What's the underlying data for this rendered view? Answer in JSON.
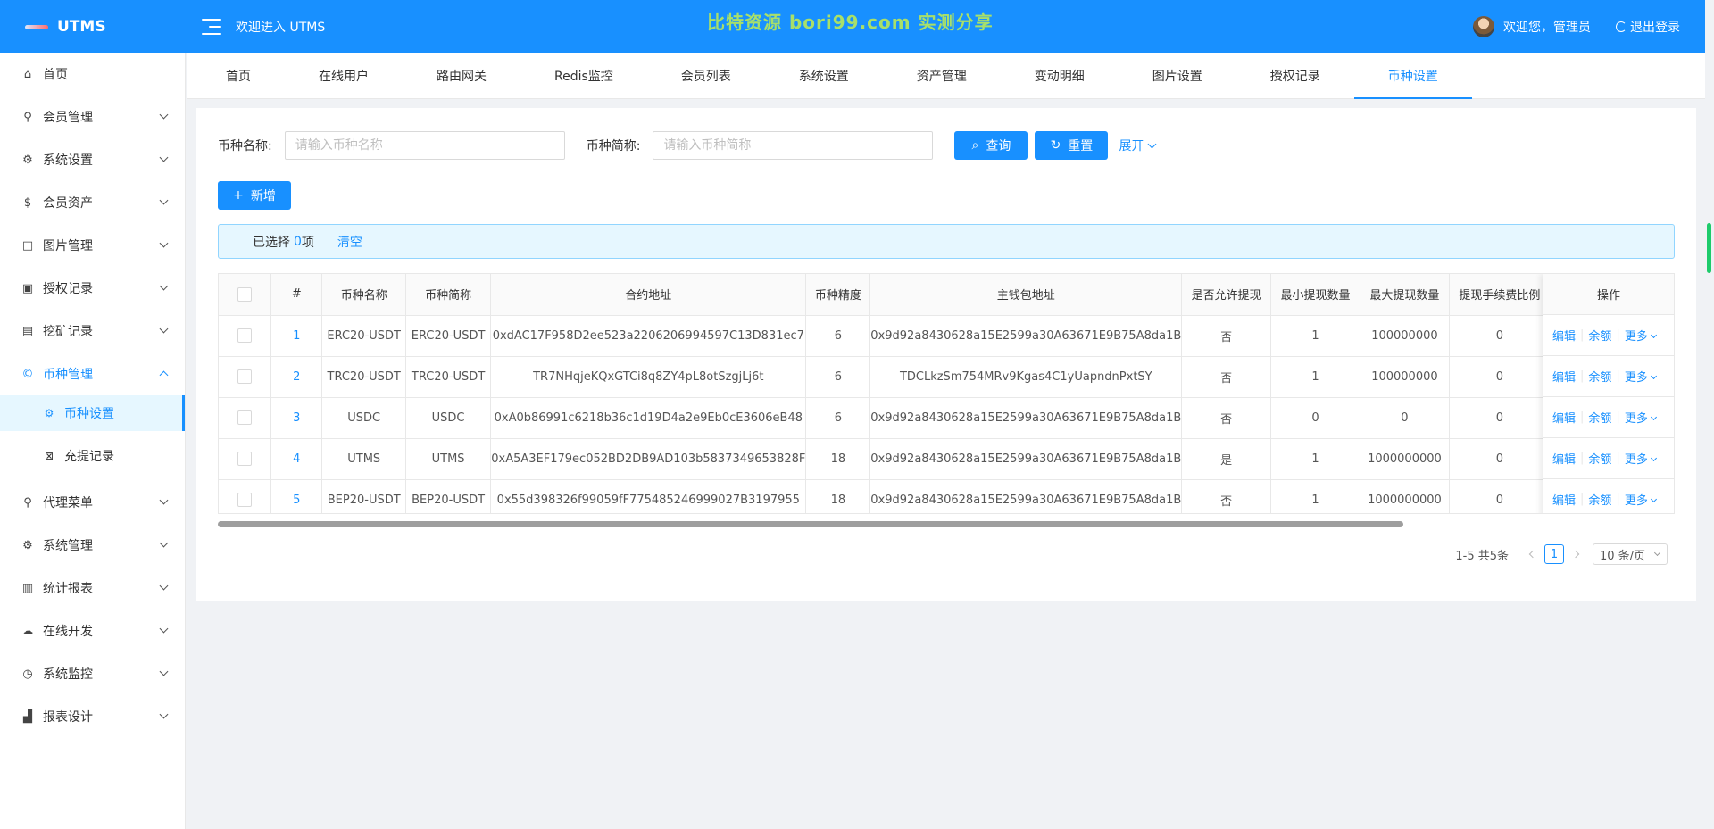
{
  "header": {
    "brand": "UTMS",
    "welcome_system": "欢迎进入 UTMS",
    "watermark": "比特资源  bori99.com  实测分享",
    "welcome_user": "欢迎您，管理员",
    "logout": "退出登录"
  },
  "sidebar": {
    "items": [
      {
        "label": "首页",
        "icon": "home-icon"
      },
      {
        "label": "会员管理",
        "icon": "user-icon"
      },
      {
        "label": "系统设置",
        "icon": "gear-icon"
      },
      {
        "label": "会员资产",
        "icon": "dollar-icon"
      },
      {
        "label": "图片管理",
        "icon": "square-icon"
      },
      {
        "label": "授权记录",
        "icon": "picture-icon"
      },
      {
        "label": "挖矿记录",
        "icon": "file-icon"
      },
      {
        "label": "币种管理",
        "icon": "copyright-icon"
      },
      {
        "label": "代理菜单",
        "icon": "user-icon"
      },
      {
        "label": "系统管理",
        "icon": "gear-icon"
      },
      {
        "label": "统计报表",
        "icon": "bar-chart-icon"
      },
      {
        "label": "在线开发",
        "icon": "cloud-icon"
      },
      {
        "label": "系统监控",
        "icon": "dashboard-icon"
      },
      {
        "label": "报表设计",
        "icon": "area-chart-icon"
      }
    ],
    "sub_items": [
      {
        "label": "币种设置",
        "icon": "gear-icon"
      },
      {
        "label": "充提记录",
        "icon": "audit-icon"
      }
    ]
  },
  "tabs": [
    "首页",
    "在线用户",
    "路由网关",
    "Redis监控",
    "会员列表",
    "系统设置",
    "资产管理",
    "变动明细",
    "图片设置",
    "授权记录",
    "币种设置"
  ],
  "search": {
    "name_label": "币种名称:",
    "name_placeholder": "请输入币种名称",
    "short_label": "币种简称:",
    "short_placeholder": "请输入币种简称",
    "query": "查询",
    "reset": "重置",
    "expand": "展开"
  },
  "add_button": "新增",
  "selection": {
    "prefix": "已选择",
    "count": "0",
    "suffix": "项",
    "clear": "清空"
  },
  "table": {
    "columns": [
      "#",
      "币种名称",
      "币种简称",
      "合约地址",
      "币种精度",
      "主钱包地址",
      "是否允许提现",
      "最小提现数量",
      "最大提现数量",
      "提现手续费比例"
    ],
    "action_header": "操作",
    "actions": {
      "edit": "编辑",
      "balance": "余额",
      "more": "更多"
    },
    "rows": [
      [
        "1",
        "ERC20-USDT",
        "ERC20-USDT",
        "0xdAC17F958D2ee523a2206206994597C13D831ec7",
        "6",
        "0x9d92a8430628a15E2599a30A63671E9B75A8da1B",
        "否",
        "1",
        "100000000",
        "0"
      ],
      [
        "2",
        "TRC20-USDT",
        "TRC20-USDT",
        "TR7NHqjeKQxGTCi8q8ZY4pL8otSzgjLj6t",
        "6",
        "TDCLkzSm754MRv9Kgas4C1yUapndnPxtSY",
        "否",
        "1",
        "100000000",
        "0"
      ],
      [
        "3",
        "USDC",
        "USDC",
        "0xA0b86991c6218b36c1d19D4a2e9Eb0cE3606eB48",
        "6",
        "0x9d92a8430628a15E2599a30A63671E9B75A8da1B",
        "否",
        "0",
        "0",
        "0"
      ],
      [
        "4",
        "UTMS",
        "UTMS",
        "0xA5A3EF179ec052BD2DB9AD103b5837349653828F",
        "18",
        "0x9d92a8430628a15E2599a30A63671E9B75A8da1B",
        "是",
        "1",
        "1000000000",
        "0"
      ],
      [
        "5",
        "BEP20-USDT",
        "BEP20-USDT",
        "0x55d398326f99059fF775485246999027B3197955",
        "18",
        "0x9d92a8430628a15E2599a30A63671E9B75A8da1B",
        "否",
        "1",
        "1000000000",
        "0"
      ]
    ]
  },
  "pagination": {
    "total": "1-5 共5条",
    "current": "1",
    "page_size": "10 条/页"
  },
  "colors": {
    "primary": "#1890ff",
    "watermark": "#a8e06a",
    "scroll_accent": "#1ecb6b"
  }
}
